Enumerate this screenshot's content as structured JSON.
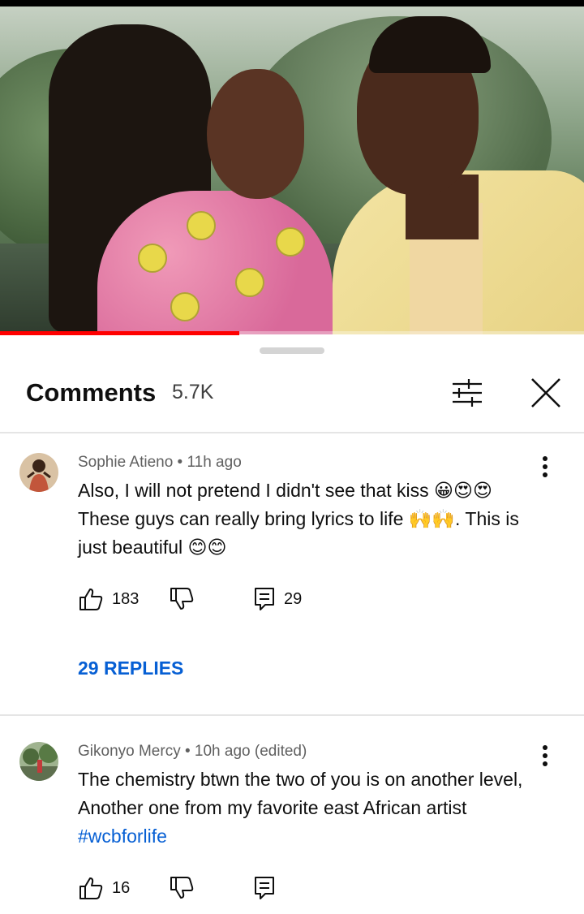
{
  "video": {
    "progress_fraction": 0.41
  },
  "header": {
    "title": "Comments",
    "count": "5.7K",
    "filter_icon": "sliders-icon",
    "close_icon": "close-icon"
  },
  "comments": [
    {
      "author": "Sophie Atieno",
      "separator": "•",
      "time": "11h ago",
      "text_line1": "Also, I will not pretend I didn't see that kiss 😀😍😍",
      "text_line2": "These  guys can really bring lyrics to life 🙌🙌. This is",
      "text_line3": "just beautiful 😊😊",
      "likes": "183",
      "reply_count": "29",
      "replies_label": "29 REPLIES"
    },
    {
      "author": "Gikonyo Mercy",
      "separator": "•",
      "time": "10h ago (edited)",
      "text_line1": "The chemistry btwn the two of you is on another level,",
      "text_line2": "Another one  from my favorite east African artist",
      "hashtag": "#wcbforlife",
      "likes": "16"
    }
  ],
  "icons": {
    "like": "thumbs-up-icon",
    "dislike": "thumbs-down-icon",
    "reply": "reply-icon",
    "more": "more-vert-icon"
  },
  "colors": {
    "progress": "#ff0000",
    "link": "#065fd4",
    "text": "#0f0f0f",
    "meta": "#606060"
  }
}
